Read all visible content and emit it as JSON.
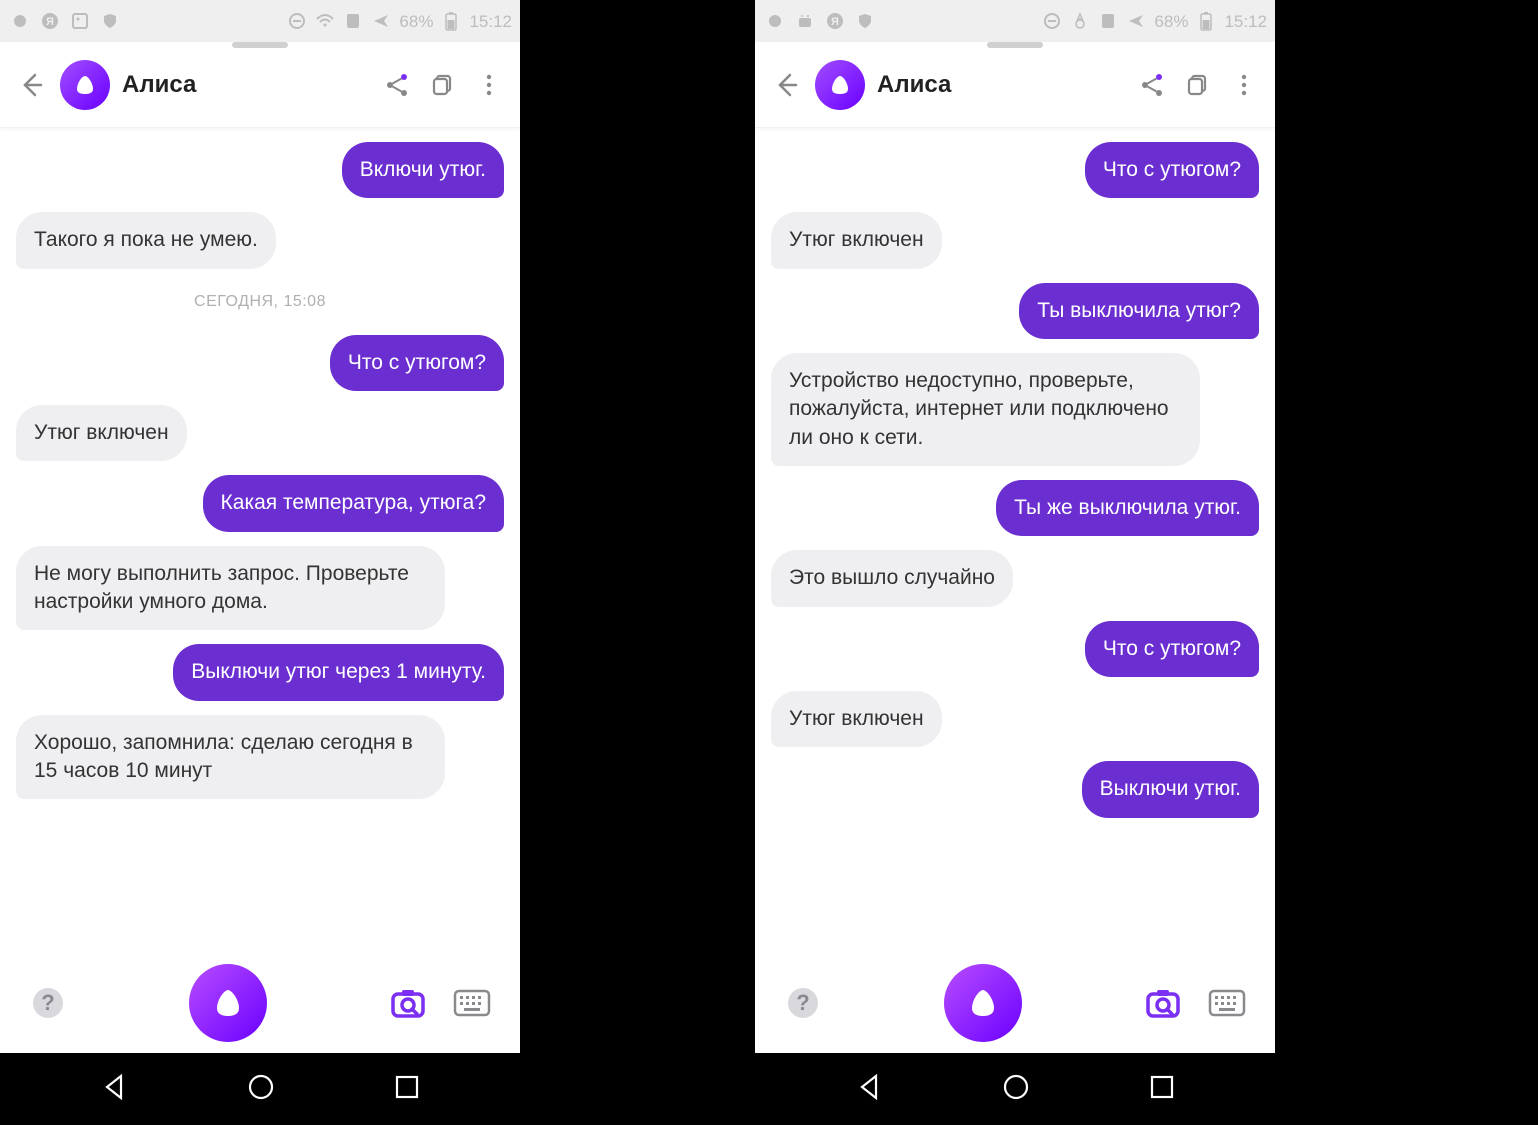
{
  "statusbar": {
    "battery_pct": "68%",
    "time": "15:12"
  },
  "header": {
    "title": "Алиса"
  },
  "screens": [
    {
      "messages": [
        {
          "role": "user",
          "text": "Включи утюг."
        },
        {
          "role": "bot",
          "text": "Такого я пока не умею."
        },
        {
          "role": "timestamp",
          "text": "СЕГОДНЯ, 15:08"
        },
        {
          "role": "user",
          "text": "Что с утюгом?"
        },
        {
          "role": "bot",
          "text": "Утюг включен"
        },
        {
          "role": "user",
          "text": "Какая температура, утюга?"
        },
        {
          "role": "bot",
          "text": "Не могу выполнить запрос. Проверьте настройки умного дома."
        },
        {
          "role": "user",
          "text": "Выключи утюг через 1 минуту."
        },
        {
          "role": "bot",
          "text": "Хорошо, запомнила: сделаю сегодня в 15 часов 10 минут"
        }
      ]
    },
    {
      "messages": [
        {
          "role": "user",
          "text": "Что с утюгом?"
        },
        {
          "role": "bot",
          "text": "Утюг включен"
        },
        {
          "role": "user",
          "text": "Ты выключила утюг?"
        },
        {
          "role": "bot",
          "text": "Устройство недоступно, проверьте, пожалуйста, интернет или подключено ли оно к сети."
        },
        {
          "role": "user",
          "text": "Ты же выключила утюг."
        },
        {
          "role": "bot",
          "text": "Это вышло случайно"
        },
        {
          "role": "user",
          "text": "Что с утюгом?"
        },
        {
          "role": "bot",
          "text": "Утюг включен"
        },
        {
          "role": "user",
          "text": "Выключи утюг."
        }
      ]
    }
  ]
}
